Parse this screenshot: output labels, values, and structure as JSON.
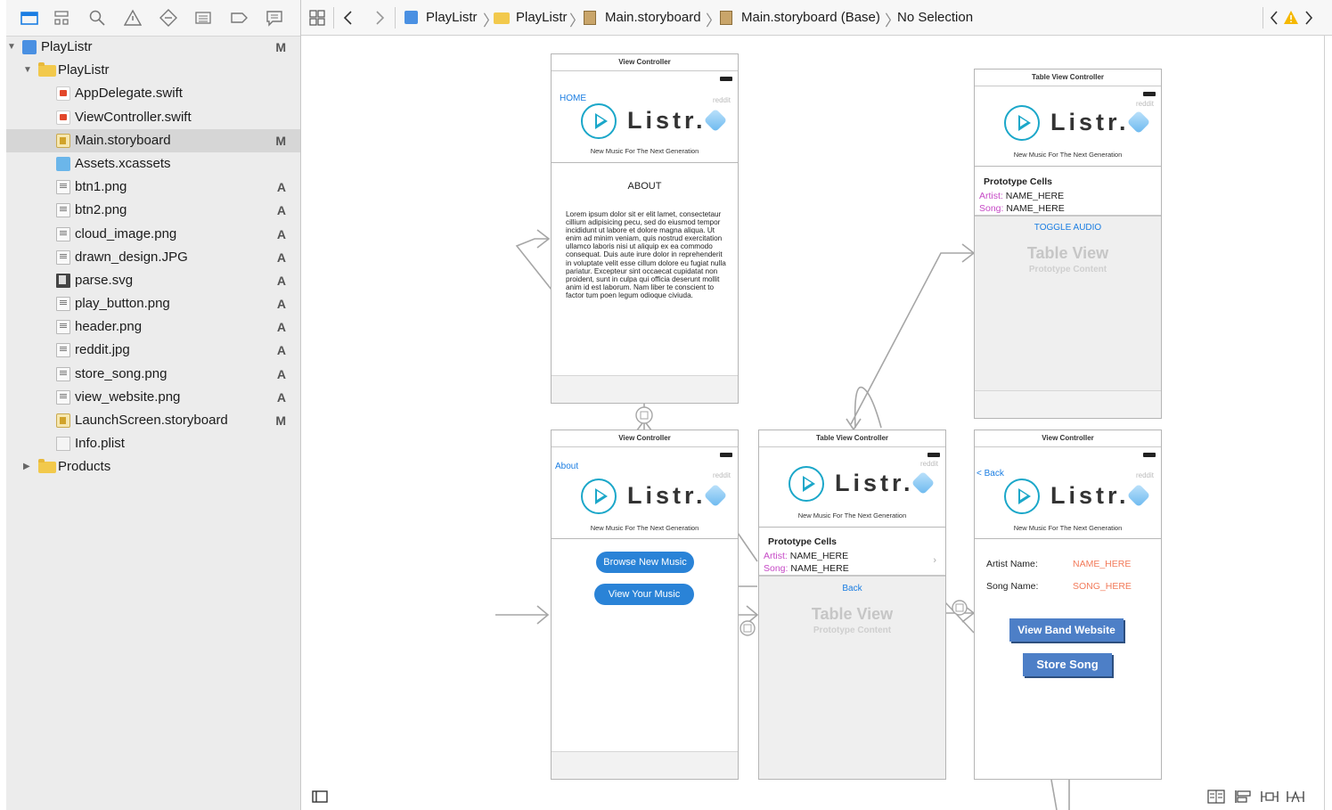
{
  "navigator": {
    "toolbar_icons": [
      "folder-icon",
      "hierarchy-icon",
      "search-icon",
      "warning-icon",
      "test-icon",
      "debug-icon",
      "breakpoint-icon",
      "report-icon"
    ],
    "items": [
      {
        "label": "PlayListr",
        "status": "M",
        "kind": "project",
        "indent": 0,
        "disclosure": "open"
      },
      {
        "label": "PlayListr",
        "status": "",
        "kind": "folder",
        "indent": 1,
        "disclosure": "open"
      },
      {
        "label": "AppDelegate.swift",
        "status": "",
        "kind": "swift",
        "indent": 2
      },
      {
        "label": "ViewController.swift",
        "status": "",
        "kind": "swift",
        "indent": 2
      },
      {
        "label": "Main.storyboard",
        "status": "M",
        "kind": "storyboard",
        "indent": 2,
        "selected": true
      },
      {
        "label": "Assets.xcassets",
        "status": "",
        "kind": "assets",
        "indent": 2
      },
      {
        "label": "btn1.png",
        "status": "A",
        "kind": "png",
        "indent": 2
      },
      {
        "label": "btn2.png",
        "status": "A",
        "kind": "png",
        "indent": 2
      },
      {
        "label": "cloud_image.png",
        "status": "A",
        "kind": "png",
        "indent": 2
      },
      {
        "label": "drawn_design.JPG",
        "status": "A",
        "kind": "png",
        "indent": 2
      },
      {
        "label": "parse.svg",
        "status": "A",
        "kind": "svg",
        "indent": 2
      },
      {
        "label": "play_button.png",
        "status": "A",
        "kind": "png",
        "indent": 2
      },
      {
        "label": "header.png",
        "status": "A",
        "kind": "png",
        "indent": 2
      },
      {
        "label": "reddit.jpg",
        "status": "A",
        "kind": "png",
        "indent": 2
      },
      {
        "label": "store_song.png",
        "status": "A",
        "kind": "png",
        "indent": 2
      },
      {
        "label": "view_website.png",
        "status": "A",
        "kind": "png",
        "indent": 2
      },
      {
        "label": "LaunchScreen.storyboard",
        "status": "M",
        "kind": "storyboard",
        "indent": 2
      },
      {
        "label": "Info.plist",
        "status": "",
        "kind": "plist",
        "indent": 2
      },
      {
        "label": "Products",
        "status": "",
        "kind": "folder",
        "indent": 1,
        "disclosure": "closed"
      }
    ]
  },
  "jumpbar": {
    "crumbs": [
      "PlayListr",
      "PlayListr",
      "Main.storyboard",
      "Main.storyboard (Base)",
      "No Selection"
    ],
    "issue_count_icon": "warning-icon"
  },
  "scenes": {
    "about_vc": {
      "title": "View Controller",
      "nav_link": "HOME",
      "reddit": "reddit",
      "logo": "Listr.",
      "tagline": "New Music For The Next Generation",
      "heading": "ABOUT",
      "body": "Lorem ipsum dolor sit er elit lamet, consectetaur cillium adipisicing pecu, sed do eiusmod tempor incididunt ut labore et dolore magna aliqua. Ut enim ad minim veniam, quis nostrud exercitation ullamco laboris nisi ut aliquip ex ea commodo consequat. Duis aute irure dolor in reprehenderit in voluptate velit esse cillum dolore eu fugiat nulla pariatur. Excepteur sint occaecat cupidatat non proident, sunt in culpa qui officia deserunt mollit anim id est laborum. Nam liber te conscient to factor tum poen legum odioque civiuda."
    },
    "table_top": {
      "title": "Table View Controller",
      "reddit": "reddit",
      "logo": "Listr.",
      "tagline": "New Music For The Next Generation",
      "proto": "Prototype Cells",
      "artist_key": "Artist:",
      "artist_val": "NAME_HERE",
      "song_key": "Song:",
      "song_val": "NAME_HERE",
      "toggle": "TOGGLE AUDIO",
      "tv": "Table View",
      "tv_sub": "Prototype Content"
    },
    "home_vc": {
      "title": "View Controller",
      "nav_link": "About",
      "reddit": "reddit",
      "logo": "Listr.",
      "tagline": "New Music For The Next Generation",
      "browse": "Browse New Music",
      "view": "View Your Music"
    },
    "table_mid": {
      "title": "Table View Controller",
      "reddit": "reddit",
      "logo": "Listr.",
      "tagline": "New Music For The Next Generation",
      "proto": "Prototype Cells",
      "artist_key": "Artist:",
      "artist_val": "NAME_HERE",
      "song_key": "Song:",
      "song_val": "NAME_HERE",
      "back": "Back",
      "tv": "Table View",
      "tv_sub": "Prototype Content"
    },
    "detail_vc": {
      "title": "View Controller",
      "nav_link": "< Back",
      "reddit": "reddit",
      "logo": "Listr.",
      "tagline": "New Music For The Next Generation",
      "artist_label": "Artist Name:",
      "artist_val": "NAME_HERE",
      "song_label": "Song Name:",
      "song_val": "SONG_HERE",
      "website_btn": "View Band Website",
      "store_btn": "Store Song"
    }
  },
  "colors": {
    "accent": "#1a7de2",
    "logo": "#1ba7c9",
    "placeholder": "#f27a5a",
    "cell_key": "#c649c6",
    "button": "#2a83d7"
  }
}
